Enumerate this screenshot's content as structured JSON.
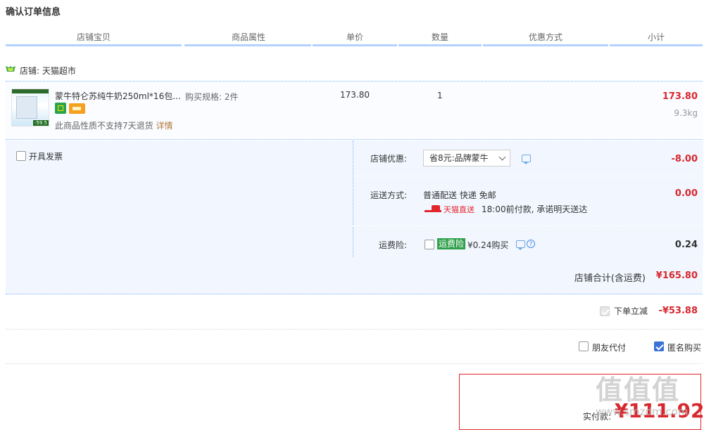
{
  "page_title": "确认订单信息",
  "columns": [
    "店铺宝贝",
    "商品属性",
    "单价",
    "数量",
    "优惠方式",
    "小计"
  ],
  "shop": {
    "label": "店铺: 天猫超市"
  },
  "item": {
    "title": "蒙牛特仑苏纯牛奶250ml*16包...",
    "thumb_price": "-59.5",
    "spec": "购买规格: 2件",
    "unit_price": "173.80",
    "quantity": "1",
    "subtotal": "173.80",
    "weight": "9.3kg",
    "return_note": "此商品性质不支持7天退货",
    "details_link": "详情"
  },
  "invoice": {
    "label": "开具发票",
    "checked": false
  },
  "shop_discount": {
    "label": "店铺优惠:",
    "selected": "省8元:品牌蒙牛",
    "amount": "-8.00"
  },
  "shipping": {
    "label": "运送方式:",
    "method": "普通配送 快递 免邮",
    "tmall_label": "天猫直送",
    "promise": "18:00前付款, 承诺明天送达",
    "amount": "0.00"
  },
  "insurance": {
    "label": "运费险:",
    "tag": "运费险",
    "price": "¥0.24购买",
    "amount": "0.24",
    "checked": false
  },
  "shop_total": {
    "label": "店铺合计(含运费)",
    "amount": "¥165.80"
  },
  "instant_discount": {
    "label": "下单立减",
    "amount": "-¥53.88",
    "checked": true
  },
  "pay_options": {
    "friend_pay": "朋友代付",
    "friend_checked": false,
    "anonymous": "匿名购买",
    "anonymous_checked": true
  },
  "final": {
    "label": "实付款:",
    "amount": "¥111.92"
  },
  "watermark": {
    "mark": "值值值",
    "url": "www.smzdm.com"
  },
  "colors": {
    "accent_red": "#d7282f",
    "accent_blue": "#b2d1ff",
    "panel_bg": "#f2f7ff"
  }
}
